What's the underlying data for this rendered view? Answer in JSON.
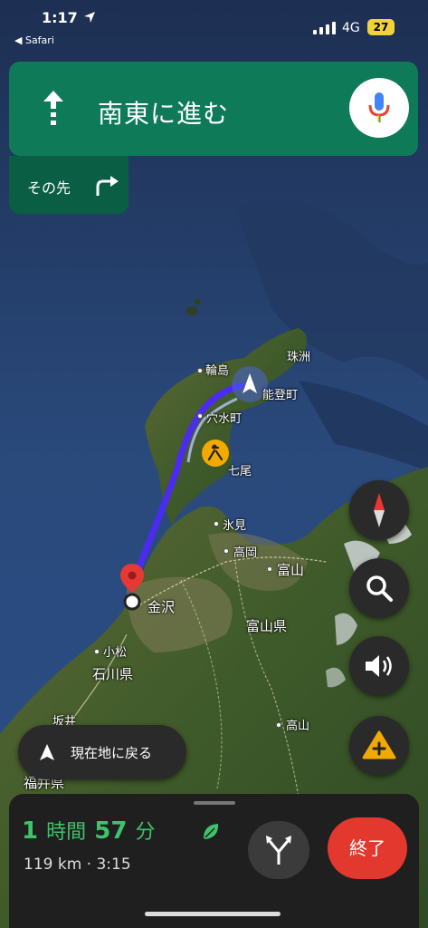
{
  "status_bar": {
    "time": "1:17",
    "back_app": "◀ Safari",
    "network": "4G",
    "battery": "27"
  },
  "navigation": {
    "instruction": "南東に進む",
    "then_label": "その先"
  },
  "map": {
    "places": {
      "suzu": "珠洲",
      "wajima": "輪島",
      "noto": "能登町",
      "anamizu": "穴水町",
      "nanao": "七尾",
      "himi": "氷見",
      "takaoka": "高岡",
      "toyama": "富山",
      "kanazawa": "金沢",
      "toyama_pref": "富山県",
      "komatsu": "小松",
      "ishikawa_pref": "石川県",
      "sakai": "坂井",
      "takayama": "高山",
      "fukui_pref": "福井県"
    }
  },
  "controls": {
    "recenter_label": "現在地に戻る"
  },
  "trip": {
    "hours": "1",
    "hours_unit": "時間",
    "minutes": "57",
    "minutes_unit": "分",
    "distance_arrival": "119 km · 3:15",
    "exit_label": "終了"
  },
  "colors": {
    "banner": "#0f7a57",
    "route": "#4b2bf0",
    "eta": "#3dc46b",
    "exit": "#e3382e"
  }
}
